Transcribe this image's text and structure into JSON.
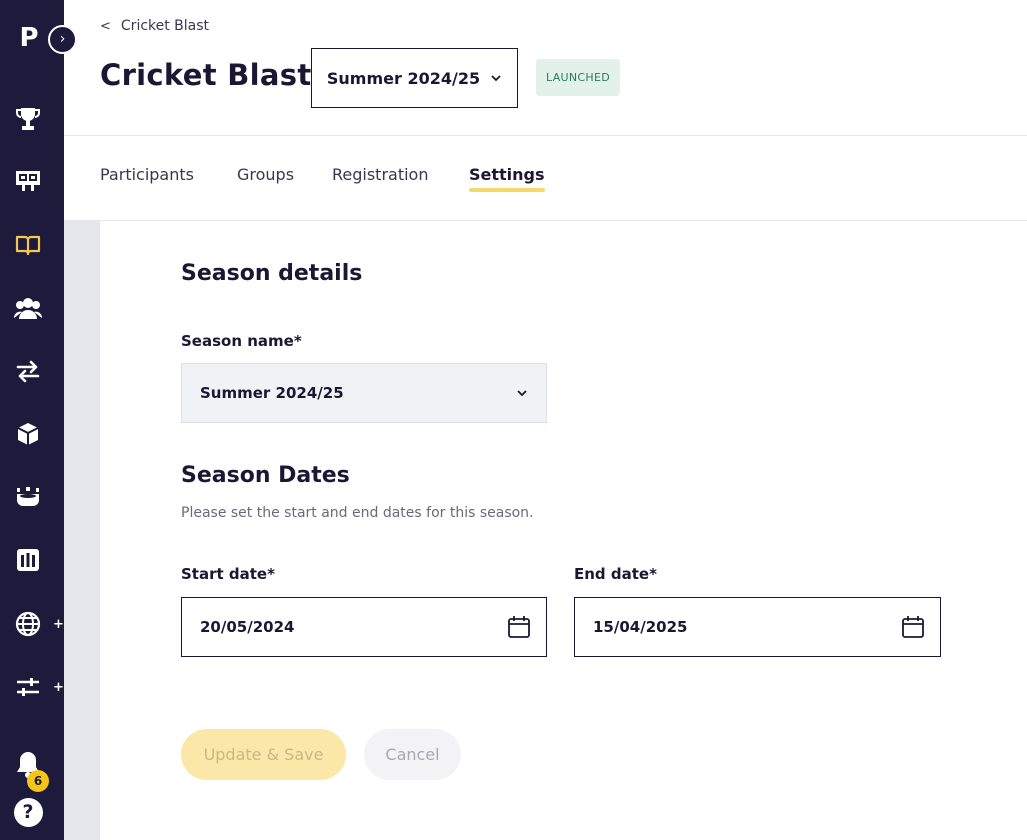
{
  "sidebar": {
    "logo": "P",
    "expand_glyph": "›",
    "icons": [
      "trophy-icon",
      "scoreboard-icon",
      "book-icon",
      "team-icon",
      "transfer-icon",
      "package-icon",
      "stadium-icon",
      "calendar-grid-icon",
      "globe-icon",
      "sliders-icon"
    ],
    "plus": "+",
    "bell_badge": "6",
    "help": "?"
  },
  "header": {
    "breadcrumb": "Cricket Blast",
    "title": "Cricket Blast",
    "season": "Summer 2024/25",
    "status": "LAUNCHED"
  },
  "tabs": [
    "Participants",
    "Groups",
    "Registration",
    "Settings"
  ],
  "season_details": {
    "heading": "Season details",
    "name_label": "Season name*",
    "name_value": "Summer 2024/25"
  },
  "season_dates": {
    "heading": "Season Dates",
    "help": "Please set the start and end dates for this season.",
    "start_label": "Start date*",
    "start_value": "20/05/2024",
    "end_label": "End date*",
    "end_value": "15/04/2025"
  },
  "actions": {
    "save": "Update & Save",
    "cancel": "Cancel"
  },
  "colors": {
    "sidebar_bg": "#1e1a3c",
    "accent_yellow": "#f7d86a",
    "active_icon": "#f2c94c",
    "status_green": "#2a7d5b"
  }
}
